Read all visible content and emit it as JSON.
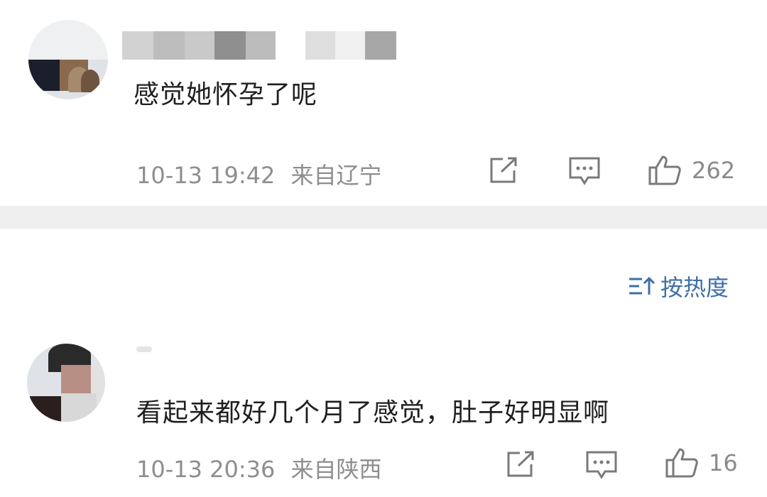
{
  "comments": [
    {
      "text": "感觉她怀孕了呢",
      "time": "10-13 19:42",
      "location": "来自辽宁",
      "likes": "262",
      "icons": [
        "share-icon",
        "reply-icon",
        "like-icon"
      ]
    },
    {
      "text": "看起来都好几个月了感觉，肚子好明显啊",
      "time": "10-13 20:36",
      "location": "来自陕西",
      "likes": "16",
      "icons": [
        "share-icon",
        "reply-icon",
        "like-icon"
      ]
    }
  ],
  "sort": {
    "label": "按热度",
    "icon": "sort-icon"
  },
  "colors": {
    "accent": "#3d6fa8",
    "meta": "#8e8e8e",
    "divider": "#efefef"
  }
}
